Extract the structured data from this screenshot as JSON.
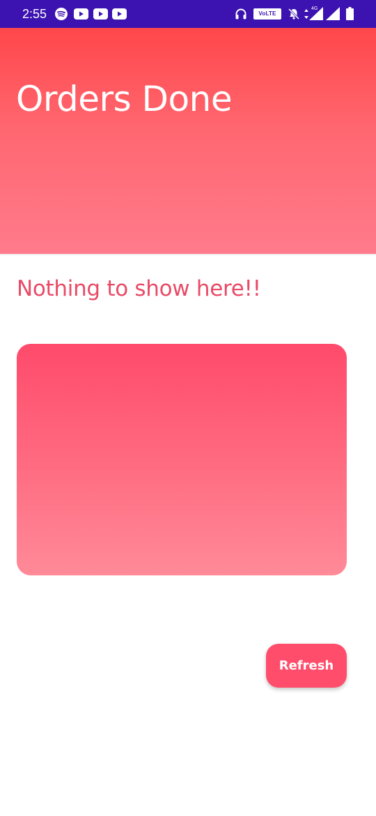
{
  "status_bar": {
    "time": "2:55",
    "volte_label": "VoLTE",
    "network_label": "4G",
    "icons": [
      "spotify-icon",
      "youtube-icon",
      "youtube-icon",
      "youtube-icon",
      "headset-icon",
      "volte-icon",
      "bell-off-icon",
      "data-arrows-icon",
      "signal-icon",
      "signal-icon",
      "battery-icon"
    ],
    "background_color": "#3c12b0"
  },
  "header": {
    "title": "Orders Done",
    "gradient_top": "#ff474b",
    "gradient_bottom": "#ff7b8c"
  },
  "main": {
    "empty_message": "Nothing to show here!!",
    "message_color": "#e94a66",
    "card_gradient_top": "#ff4a6b",
    "card_gradient_bottom": "#ff8a98"
  },
  "actions": {
    "refresh_label": "Refresh",
    "refresh_color": "#ff4d6b"
  }
}
